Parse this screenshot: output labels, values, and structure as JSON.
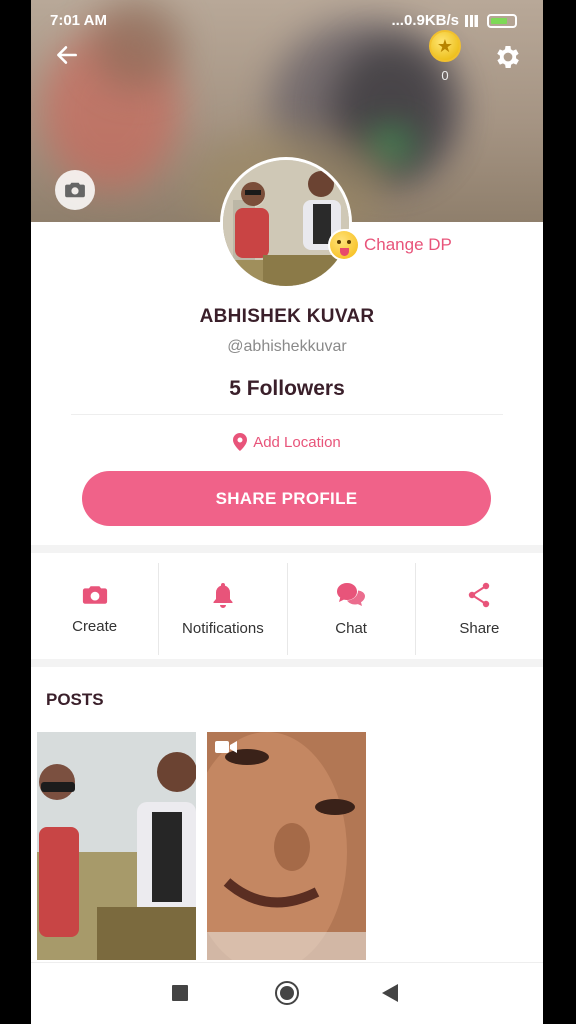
{
  "status_bar": {
    "time": "7:01 AM",
    "network_speed": "...0.9KB/s"
  },
  "header": {
    "coin_count": "0",
    "back_icon": "arrow-left-icon",
    "settings_icon": "gear-icon",
    "camera_icon": "camera-icon"
  },
  "profile": {
    "change_dp_label": "Change DP",
    "name": "ABHISHEK KUVAR",
    "handle": "@abhishekkuvar",
    "followers": "5 Followers",
    "location_label": "Add Location",
    "share_button": "SHARE PROFILE"
  },
  "actions": [
    {
      "label": "Create",
      "icon": "camera-icon"
    },
    {
      "label": "Notifications",
      "icon": "bell-icon"
    },
    {
      "label": "Chat",
      "icon": "chat-icon"
    },
    {
      "label": "Share",
      "icon": "share-icon"
    }
  ],
  "posts": {
    "title": "POSTS",
    "items": [
      {
        "type": "photo"
      },
      {
        "type": "video"
      }
    ]
  },
  "colors": {
    "accent": "#f06289",
    "accent_text": "#e8547a",
    "title": "#3a1f2a"
  }
}
